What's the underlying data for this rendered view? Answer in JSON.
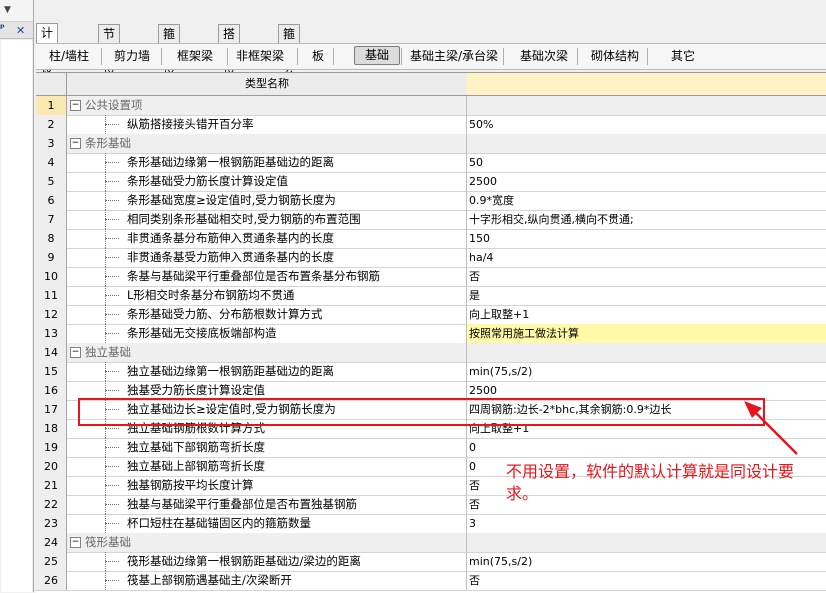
{
  "tabs_top": [
    {
      "label": "计算设置",
      "active": true
    },
    {
      "label": "节点设置",
      "active": false
    },
    {
      "label": "箍筋设置",
      "active": false
    },
    {
      "label": "搭接设置",
      "active": false
    },
    {
      "label": "箍筋公式",
      "active": false
    }
  ],
  "tabs_sub": [
    {
      "label": "柱/墙柱",
      "active": false
    },
    {
      "label": "剪力墙",
      "active": false
    },
    {
      "label": "框架梁",
      "active": false
    },
    {
      "label": "非框架梁",
      "active": false
    },
    {
      "label": "板",
      "active": false
    },
    {
      "label": "基础",
      "active": true
    },
    {
      "label": "基础主梁/承台梁",
      "active": false
    },
    {
      "label": "基础次梁",
      "active": false
    },
    {
      "label": "砌体结构",
      "active": false
    },
    {
      "label": "其它",
      "active": false
    }
  ],
  "left_pane": {
    "close": "✕"
  },
  "grid": {
    "header_name": "类型名称",
    "rows": [
      {
        "num": "1",
        "name": "公共设置项",
        "value": "",
        "group": true
      },
      {
        "num": "2",
        "name": "纵筋搭接接头错开百分率",
        "value": "50%"
      },
      {
        "num": "3",
        "name": "条形基础",
        "value": "",
        "group": true
      },
      {
        "num": "4",
        "name": "条形基础边缘第一根钢筋距基础边的距离",
        "value": "50"
      },
      {
        "num": "5",
        "name": "条形基础受力筋长度计算设定值",
        "value": "2500"
      },
      {
        "num": "6",
        "name": "条形基础宽度≥设定值时,受力钢筋长度为",
        "value": "0.9*宽度"
      },
      {
        "num": "7",
        "name": "相同类别条形基础相交时,受力钢筋的布置范围",
        "value": "十字形相交,纵向贯通,横向不贯通;"
      },
      {
        "num": "8",
        "name": "非贯通条基分布筋伸入贯通条基内的长度",
        "value": "150"
      },
      {
        "num": "9",
        "name": "非贯通条基受力筋伸入贯通条基内的长度",
        "value": "ha/4"
      },
      {
        "num": "10",
        "name": "条基与基础梁平行重叠部位是否布置条基分布钢筋",
        "value": "否"
      },
      {
        "num": "11",
        "name": "L形相交时条基分布钢筋均不贯通",
        "value": "是"
      },
      {
        "num": "12",
        "name": "条形基础受力筋、分布筋根数计算方式",
        "value": "向上取整+1"
      },
      {
        "num": "13",
        "name": "条形基础无交接底板端部构造",
        "value": "按照常用施工做法计算",
        "highlight": true
      },
      {
        "num": "14",
        "name": "独立基础",
        "value": "",
        "group": true
      },
      {
        "num": "15",
        "name": "独立基础边缘第一根钢筋距基础边的距离",
        "value": "min(75,s/2)"
      },
      {
        "num": "16",
        "name": "独基受力筋长度计算设定值",
        "value": "2500"
      },
      {
        "num": "17",
        "name": "独立基础边长≥设定值时,受力钢筋长度为",
        "value": "四周钢筋:边长-2*bhc,其余钢筋:0.9*边长"
      },
      {
        "num": "18",
        "name": "独立基础钢筋根数计算方式",
        "value": "向上取整+1"
      },
      {
        "num": "19",
        "name": "独立基础下部钢筋弯折长度",
        "value": "0"
      },
      {
        "num": "20",
        "name": "独立基础上部钢筋弯折长度",
        "value": "0"
      },
      {
        "num": "21",
        "name": "独基钢筋按平均长度计算",
        "value": "否"
      },
      {
        "num": "22",
        "name": "独基与基础梁平行重叠部位是否布置独基钢筋",
        "value": "否"
      },
      {
        "num": "23",
        "name": "杯口短柱在基础锚固区内的箍筋数量",
        "value": "3"
      },
      {
        "num": "24",
        "name": "筏形基础",
        "value": "",
        "group": true
      },
      {
        "num": "25",
        "name": "筏形基础边缘第一根钢筋距基础边/梁边的距离",
        "value": "min(75,s/2)"
      },
      {
        "num": "26",
        "name": "筏基上部钢筋遇基础主/次梁断开",
        "value": "否"
      }
    ]
  },
  "annotation": {
    "text": "不用设置，软件的默认计算就是同设计要求。",
    "color": "#e8151c"
  }
}
